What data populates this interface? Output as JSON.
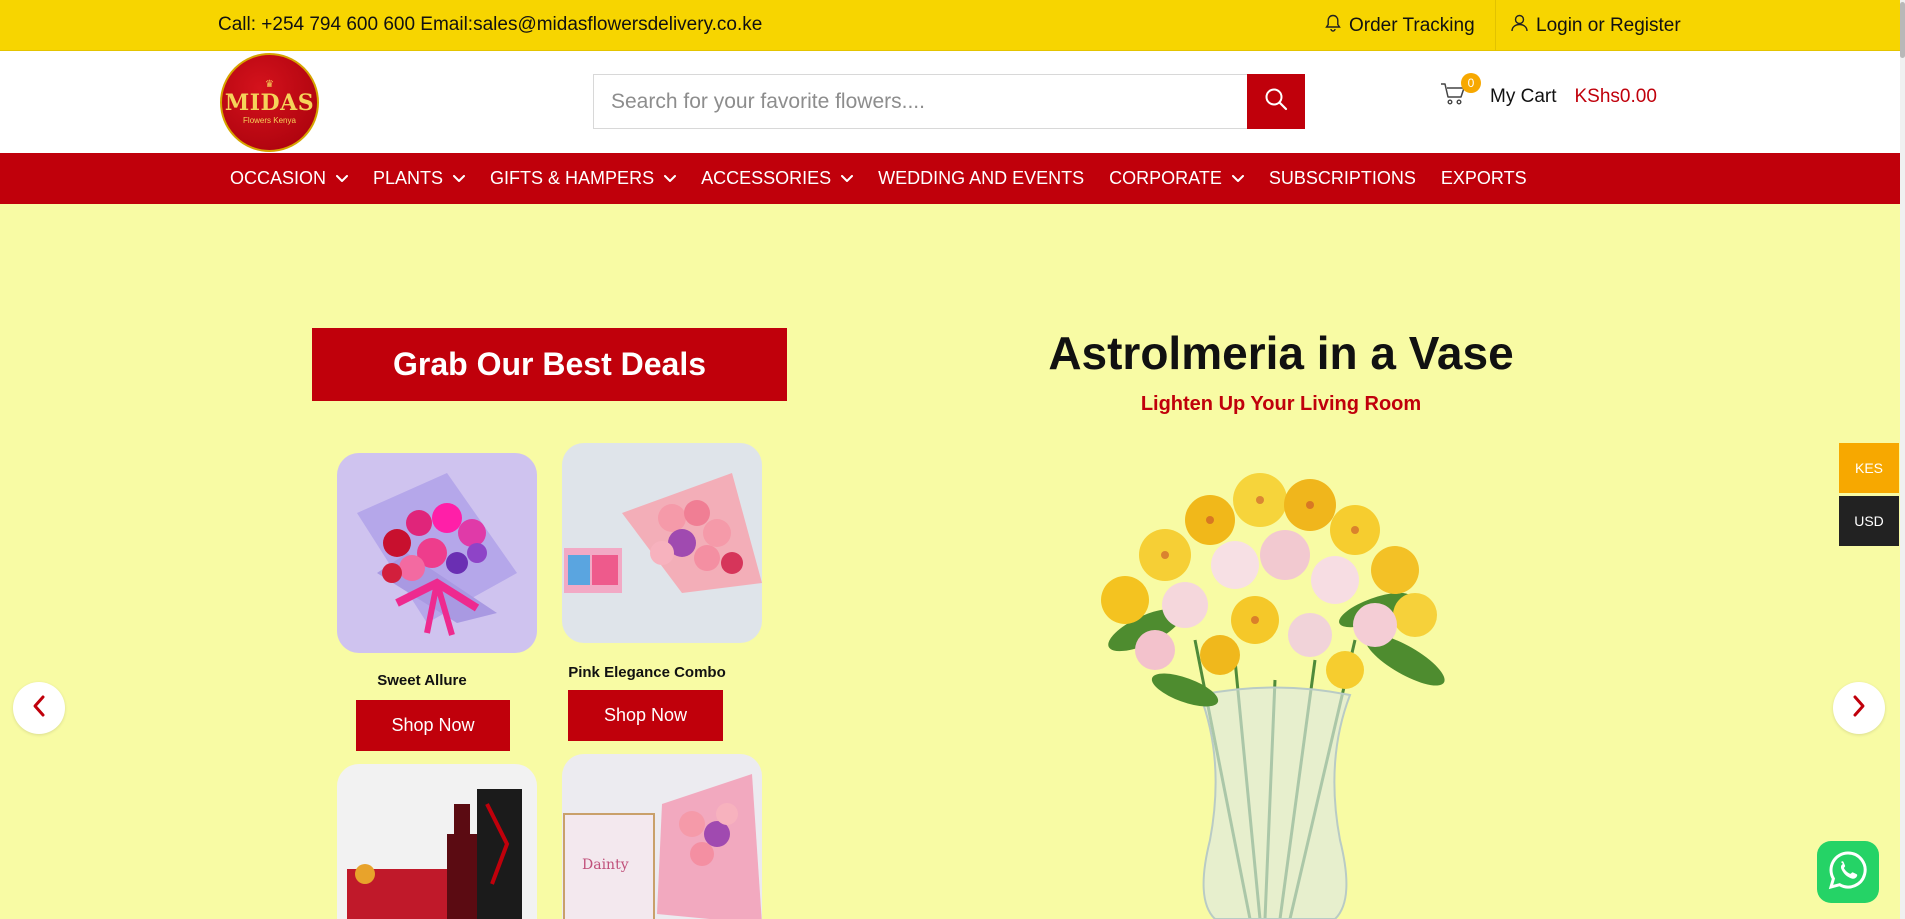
{
  "topbar": {
    "contact": "Call: +254 794 600 600 Email:sales@midasflowersdelivery.co.ke",
    "order_tracking": "Order Tracking",
    "login": "Login or Register"
  },
  "header": {
    "logo_name": "MIDAS",
    "logo_sub": "Flowers Kenya",
    "search_placeholder": "Search for your favorite flowers....",
    "cart_count": "0",
    "cart_label": "My Cart",
    "cart_amount": "KShs0.00"
  },
  "nav": {
    "items": [
      {
        "label": "OCCASION",
        "dropdown": true
      },
      {
        "label": "PLANTS",
        "dropdown": true
      },
      {
        "label": "GIFTS & HAMPERS",
        "dropdown": true
      },
      {
        "label": "ACCESSORIES",
        "dropdown": true
      },
      {
        "label": "WEDDING AND EVENTS",
        "dropdown": false
      },
      {
        "label": "CORPORATE",
        "dropdown": true
      },
      {
        "label": "SUBSCRIPTIONS",
        "dropdown": false
      },
      {
        "label": "EXPORTS",
        "dropdown": false
      }
    ]
  },
  "hero": {
    "deals_title": "Grab Our Best Deals",
    "products": [
      {
        "name": "Sweet Allure",
        "button": "Shop Now"
      },
      {
        "name": "Pink Elegance Combo",
        "button": "Shop Now"
      }
    ],
    "slide_title": "Astrolmeria in a Vase",
    "slide_subtitle": "Lighten Up Your Living Room"
  },
  "currency": {
    "options": [
      "KES",
      "USD"
    ],
    "selected": "KES"
  },
  "colors": {
    "brand_red": "#c0000b",
    "topbar_yellow": "#f7d500",
    "hero_bg": "#f8fba4",
    "accent_orange": "#f7a800"
  },
  "icons": [
    "bell-icon",
    "user-icon",
    "search-icon",
    "cart-icon",
    "chevron-down-icon",
    "chevron-left-icon",
    "chevron-right-icon",
    "whatsapp-icon"
  ]
}
